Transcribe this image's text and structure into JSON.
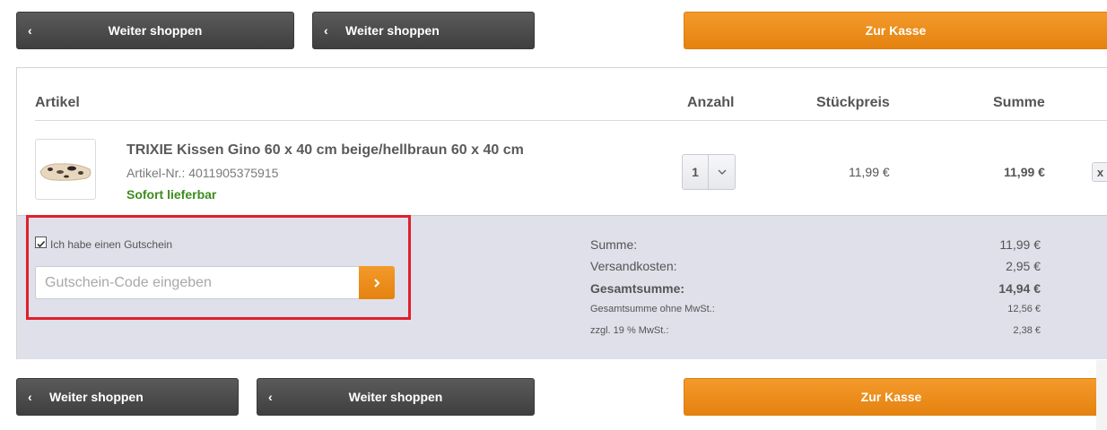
{
  "top_bar": {
    "continue_1": "Weiter shoppen",
    "continue_2": "Weiter shoppen",
    "checkout": "Zur Kasse"
  },
  "cart": {
    "headers": {
      "article": "Artikel",
      "quantity": "Anzahl",
      "unit_price": "Stückpreis",
      "total": "Summe"
    },
    "item": {
      "name": "TRIXIE Kissen Gino 60 x 40 cm beige/hellbraun 60 x 40 cm",
      "article_number": "Artikel-Nr.: 4011905375915",
      "availability": "Sofort lieferbar",
      "quantity": "1",
      "unit_price": "11,99 €",
      "total": "11,99 €",
      "remove_label": "x"
    },
    "voucher": {
      "checkbox_label": "Ich habe einen Gutschein",
      "checked": true,
      "placeholder": "Gutschein-Code eingeben"
    },
    "totals": [
      {
        "label": "Summe:",
        "value": "11,99 €"
      },
      {
        "label": "Versandkosten:",
        "value": "2,95 €"
      },
      {
        "label": "Gesamtsumme:",
        "value": "14,94 €"
      },
      {
        "label": "Gesamtsumme ohne MwSt.:",
        "value": "12,56 €"
      },
      {
        "label": "zzgl. 19 % MwSt.:",
        "value": "2,38 €"
      }
    ]
  },
  "bottom_bar": {
    "continue_1": "Weiter shoppen",
    "continue_2": "Weiter shoppen",
    "checkout": "Zur Kasse"
  },
  "colors": {
    "accent_orange": "#e8871a",
    "dark_button": "#4a4a4a",
    "availability_green": "#3d8c1e",
    "highlight_red": "#e01f2c",
    "footer_bg": "#dfe0ea"
  }
}
